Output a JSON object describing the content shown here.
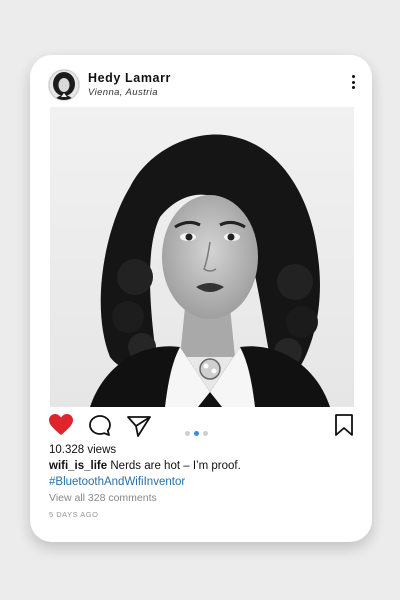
{
  "post": {
    "username": "Hedy Lamarr",
    "location": "Vienna, Austria",
    "views": "10.328 views",
    "caption_user": "wifi_is_life",
    "caption_text": "Nerds are hot – I’m proof.",
    "hashtag": "#BluetoothAndWifiInventor",
    "view_comments": "View all 328 comments",
    "timestamp": "5 DAYS AGO"
  },
  "icons": {
    "like": "heart-icon",
    "comment": "speech-bubble-icon",
    "share": "paper-plane-icon",
    "save": "bookmark-icon",
    "more": "three-dots-vertical-icon"
  },
  "carousel": {
    "count": 3,
    "active_index": 1
  },
  "colors": {
    "like": "#e0242b",
    "hashtag": "#2a6fa8",
    "active_dot": "#3a8fd6"
  }
}
